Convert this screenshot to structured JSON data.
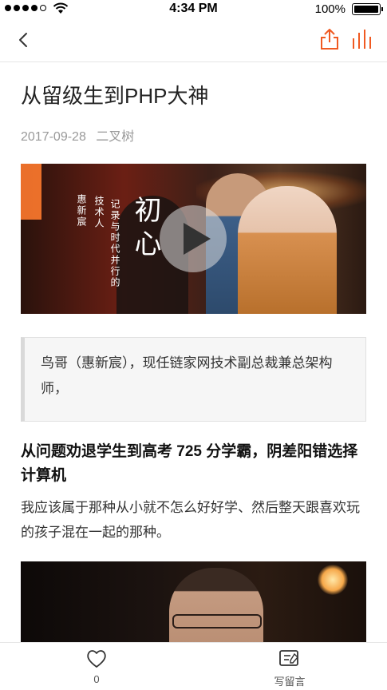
{
  "status_bar": {
    "time": "4:34 PM",
    "battery_percent": "100%",
    "battery_level": 1.0,
    "signal_bars": 4,
    "icons": [
      "signal-icon",
      "wifi-icon",
      "battery-icon"
    ]
  },
  "nav": {
    "icons": [
      "chevron-left-icon",
      "share-icon",
      "stats-icon"
    ],
    "accent_color": "#f05a22"
  },
  "article": {
    "title": "从留级生到PHP大神",
    "date": "2017-09-28",
    "author": "二叉树",
    "video": {
      "title": "初心",
      "subtitle_1": "记录与时代并行的",
      "subtitle_2": "技术人",
      "subtitle_3": "惠新宸",
      "play_icon": "play-icon"
    },
    "quote": "鸟哥（惠新宸），现任链家网技术副总裁兼总架构师，",
    "section_heading": "从问题劝退学生到高考 725 分学霸，阴差阳错选择计算机",
    "body_text": "我应该属于那种从小就不怎么好好学、然后整天跟喜欢玩的孩子混在一起的那种。"
  },
  "tab_bar": {
    "like_count": "0",
    "like_icon": "heart-icon",
    "comment_label": "写留言",
    "comment_icon": "write-comment-icon"
  }
}
